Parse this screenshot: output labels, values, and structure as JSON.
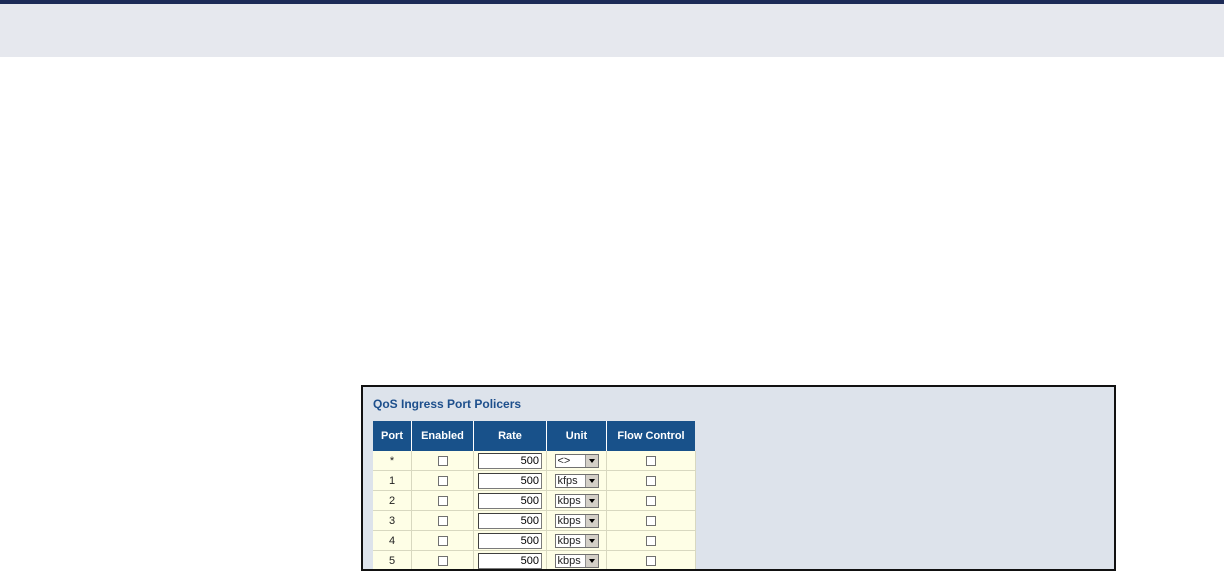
{
  "panel": {
    "title": "QoS Ingress Port Policers"
  },
  "table": {
    "headers": {
      "port": "Port",
      "enabled": "Enabled",
      "rate": "Rate",
      "unit": "Unit",
      "flow_control": "Flow Control"
    },
    "rows": [
      {
        "port": "*",
        "enabled": false,
        "rate": "500",
        "unit": "<>",
        "flow_control": false
      },
      {
        "port": "1",
        "enabled": false,
        "rate": "500",
        "unit": "kfps",
        "flow_control": false
      },
      {
        "port": "2",
        "enabled": false,
        "rate": "500",
        "unit": "kbps",
        "flow_control": false
      },
      {
        "port": "3",
        "enabled": false,
        "rate": "500",
        "unit": "kbps",
        "flow_control": false
      },
      {
        "port": "4",
        "enabled": false,
        "rate": "500",
        "unit": "kbps",
        "flow_control": false
      },
      {
        "port": "5",
        "enabled": false,
        "rate": "500",
        "unit": "kbps",
        "flow_control": false
      }
    ]
  },
  "colors": {
    "header_bg": "#18518a",
    "row_bg": "#fefee6",
    "panel_bg": "#dde3eb",
    "title_color": "#1d4f8c",
    "top_rule": "#1c2b57"
  }
}
